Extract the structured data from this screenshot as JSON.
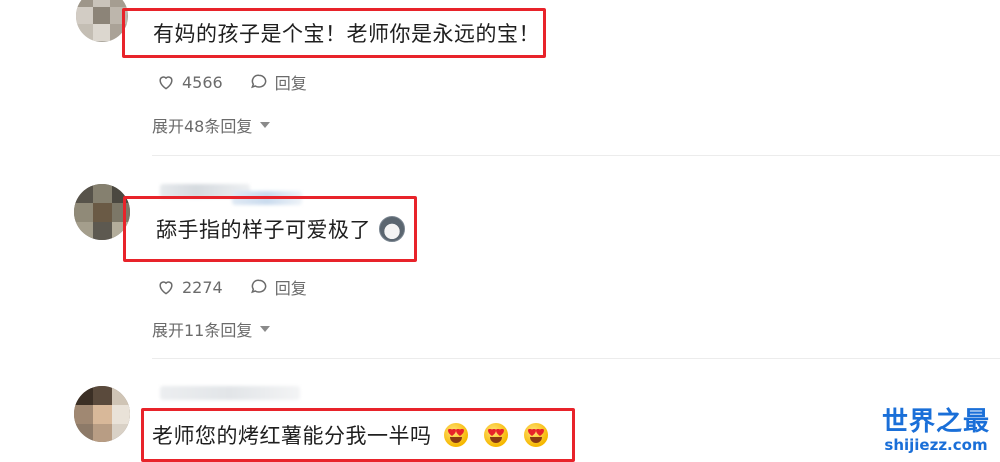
{
  "comments": [
    {
      "text": "有妈的孩子是个宝！老师你是永远的宝！",
      "likes": "4566",
      "reply_label": "回复",
      "expand_label": "展开48条回复"
    },
    {
      "text": "舔手指的样子可爱极了",
      "likes": "2274",
      "reply_label": "回复",
      "expand_label": "展开11条回复",
      "emoji": "doge-emoji"
    },
    {
      "text": "老师您的烤红薯能分我一半吗",
      "emoji": "heart-eyes-emoji",
      "emoji_count": 3
    }
  ],
  "highlight_color": "#e8232a",
  "watermark": {
    "title": "世界之最",
    "domain": "shijiezz.com",
    "color": "#1a6fd8"
  }
}
